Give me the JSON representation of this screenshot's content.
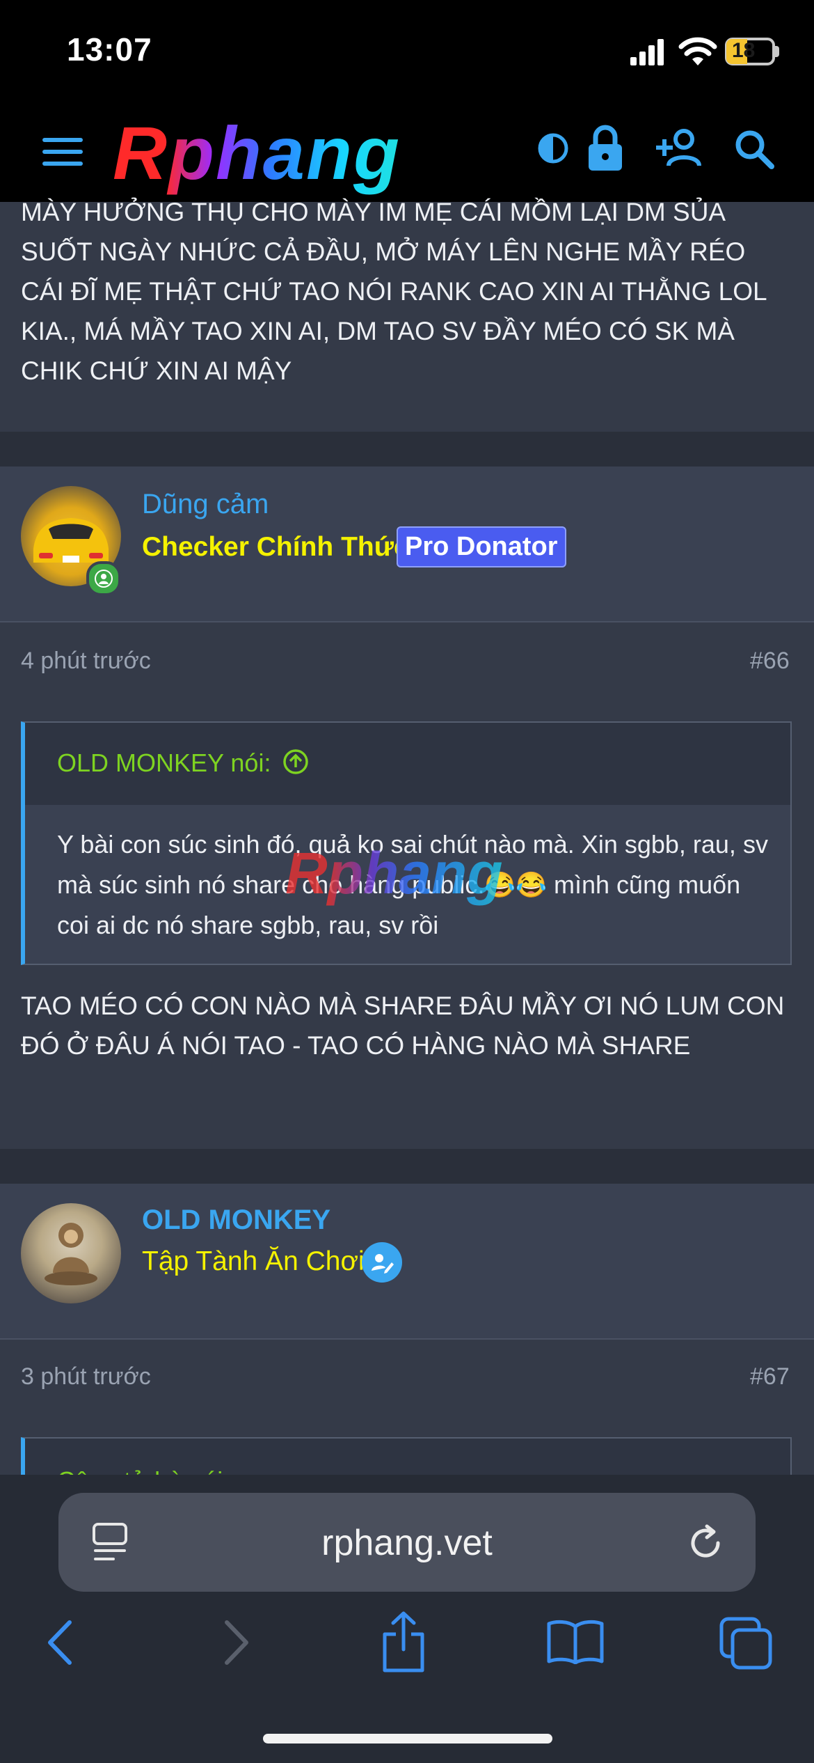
{
  "status_bar": {
    "time": "13:07",
    "battery": "18"
  },
  "header": {
    "logo": "Rphang",
    "icons": [
      "menu-icon",
      "contrast-icon",
      "lock-icon",
      "add-user-icon",
      "search-icon"
    ]
  },
  "posts": [
    {
      "text": "MÀY HƯỞNG THỤ CHO MÀY IM MẸ CÁI MỒM LẠI DM SỦA SUỐT NGÀY NHỨC CẢ ĐẦU, MỞ MÁY LÊN NGHE MẦY RÉO CÁI ĐĨ MẸ THẬT CHỨ TAO NÓI RANK CAO XIN AI THẰNG LOL KIA., MÁ MẦY TAO XIN AI, DM TAO SV ĐẦY MÉO CÓ SK MÀ CHIK CHỨ XIN AI MẬY"
    },
    {
      "user": {
        "name": "Dũng cảm",
        "title": "Checker Chính Thức",
        "badge": "Pro Donator"
      },
      "time": "4 phút trước",
      "number": "#66",
      "quote": {
        "author": "OLD MONKEY nói:",
        "text": "Y bài con súc sinh đó, quả ko sai chút nào mà. Xin sgbb, rau, sv mà súc sinh nó share cho hàng public.😂😂 mình cũng muốn coi ai dc nó share sgbb, rau, sv rồi"
      },
      "text": "TAO MÉO CÓ CON NÀO MÀ SHARE ĐÂU MẦY ƠI NÓ LUM CON ĐÓ Ở ĐÂU Á NÓI TAO - TAO CÓ HÀNG NÀO MÀ SHARE"
    },
    {
      "user": {
        "name": "OLD MONKEY",
        "title": "Tập Tành Ăn Chơi"
      },
      "time": "3 phút trước",
      "number": "#67",
      "quote": {
        "author": "Cộng tử bò nói:"
      }
    }
  ],
  "watermark": "Rphang",
  "browser": {
    "url": "rphang.vet"
  },
  "colors": {
    "accent": "#3aa6f0",
    "username": "#3aa6f0",
    "title": "#f5f200",
    "quote_author": "#7ed321",
    "badge_bg": "#4a5cf0"
  }
}
